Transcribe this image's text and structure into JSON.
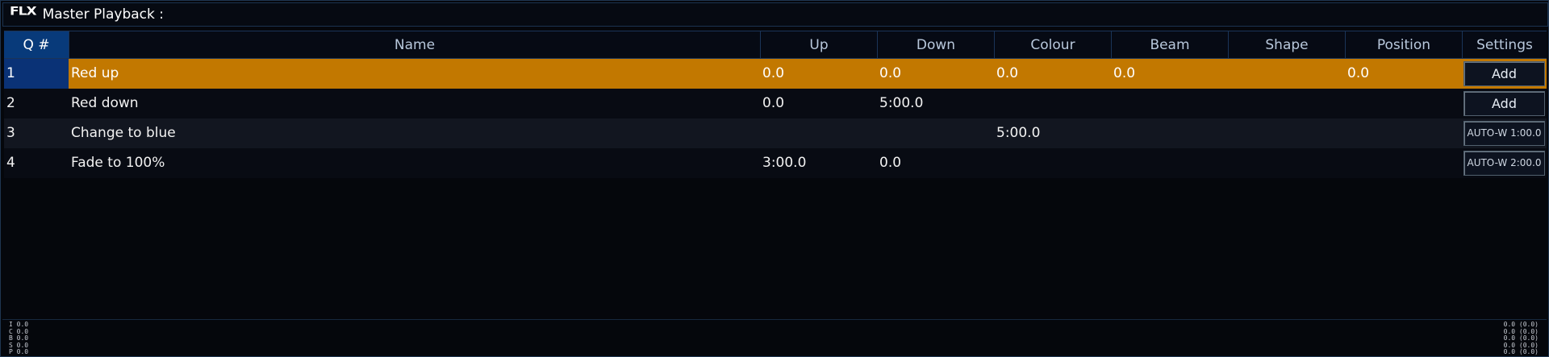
{
  "window": {
    "logo": "FLX",
    "title": "Master Playback :"
  },
  "table": {
    "headers": {
      "q": "Q #",
      "name": "Name",
      "up": "Up",
      "down": "Down",
      "colour": "Colour",
      "beam": "Beam",
      "shape": "Shape",
      "position": "Position",
      "settings": "Settings"
    },
    "rows": [
      {
        "q": "1",
        "name": "Red up",
        "up": "0.0",
        "down": "0.0",
        "colour": "0.0",
        "beam": "0.0",
        "shape": "",
        "position": "0.0",
        "settings": "Add"
      },
      {
        "q": "2",
        "name": "Red down",
        "up": "0.0",
        "down": "5:00.0",
        "colour": "",
        "beam": "",
        "shape": "",
        "position": "",
        "settings": "Add"
      },
      {
        "q": "3",
        "name": "Change to blue",
        "up": "",
        "down": "",
        "colour": "5:00.0",
        "beam": "",
        "shape": "",
        "position": "",
        "settings": "AUTO-W 1:00.0"
      },
      {
        "q": "4",
        "name": "Fade to 100%",
        "up": "3:00.0",
        "down": "0.0",
        "colour": "",
        "beam": "",
        "shape": "",
        "position": "",
        "settings": "AUTO-W 2:00.0"
      }
    ]
  },
  "footer": {
    "left": [
      "I  0.0",
      "C  0.0",
      "B  0.0",
      "S  0.0",
      "P  0.0"
    ],
    "right": [
      "0.0 (0.0)",
      "0.0 (0.0)",
      "0.0 (0.0)",
      "0.0 (0.0)",
      "0.0 (0.0)"
    ]
  },
  "colors": {
    "active_row": "#c27800",
    "header_q": "#083a7a",
    "background": "#05070c"
  }
}
